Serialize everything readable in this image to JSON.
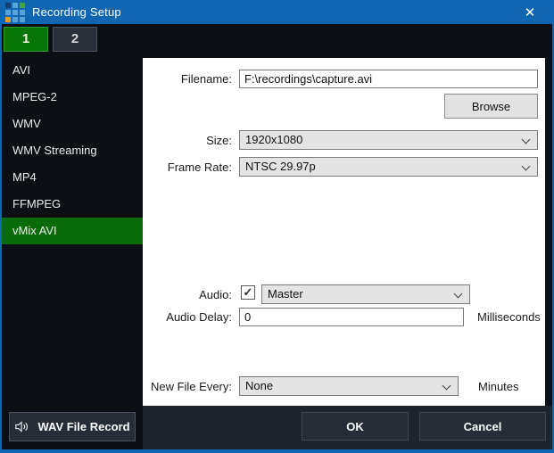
{
  "window": {
    "title": "Recording Setup"
  },
  "icons": {
    "close_glyph": "✕",
    "check_glyph": "✓"
  },
  "tabs": [
    {
      "label": "1",
      "selected": true
    },
    {
      "label": "2",
      "selected": false
    }
  ],
  "sidebar": {
    "items": [
      {
        "label": "AVI",
        "selected": false
      },
      {
        "label": "MPEG-2",
        "selected": false
      },
      {
        "label": "WMV",
        "selected": false
      },
      {
        "label": "WMV Streaming",
        "selected": false
      },
      {
        "label": "MP4",
        "selected": false
      },
      {
        "label": "FFMPEG",
        "selected": false
      },
      {
        "label": "vMix AVI",
        "selected": true
      }
    ],
    "wav_button_label": "WAV File Record"
  },
  "form": {
    "filename": {
      "label": "Filename:",
      "value": "F:\\recordings\\capture.avi"
    },
    "browse_label": "Browse",
    "size": {
      "label": "Size:",
      "value": "1920x1080"
    },
    "frame_rate": {
      "label": "Frame Rate:",
      "value": "NTSC 29.97p"
    },
    "audio": {
      "label": "Audio:",
      "checked": true,
      "value": "Master"
    },
    "audio_delay": {
      "label": "Audio Delay:",
      "value": "0",
      "unit": "Milliseconds"
    },
    "new_file_every": {
      "label": "New File Every:",
      "value": "None",
      "unit": "Minutes"
    }
  },
  "footer": {
    "ok_label": "OK",
    "cancel_label": "Cancel"
  },
  "colors": {
    "titlebar_blue": "#1066b1",
    "selected_item_green": "#0a6b0a",
    "tab_selected_green": "#077607",
    "panel_white": "#ffffff",
    "footer_dark": "#1f252d"
  }
}
